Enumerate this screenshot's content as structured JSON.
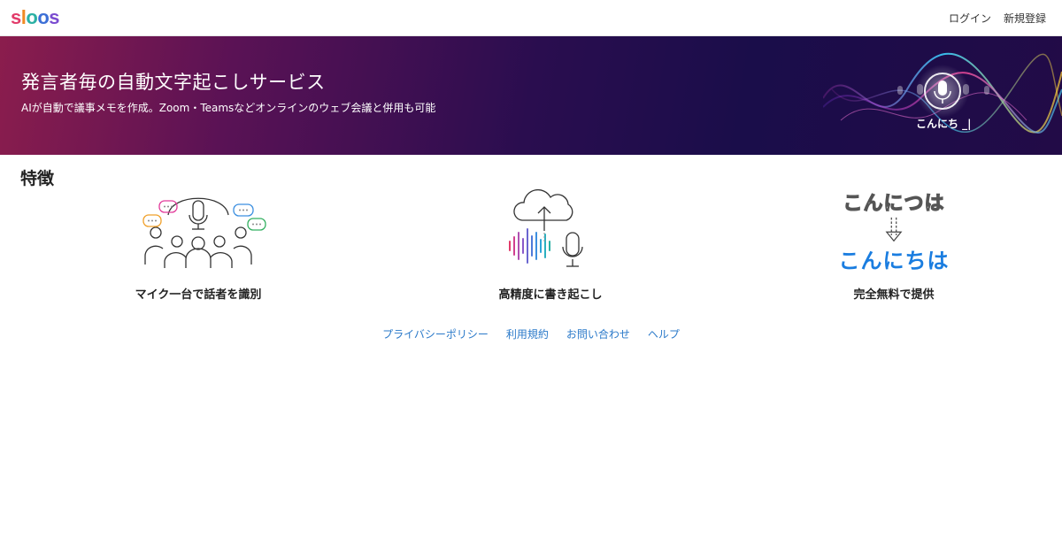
{
  "header": {
    "logo_letters": [
      "s",
      "l",
      "o",
      "o",
      "s"
    ],
    "links": {
      "login": "ログイン",
      "signup": "新規登録"
    }
  },
  "hero": {
    "title": "発言者毎の自動文字起こしサービス",
    "subtitle": "AIが自動で議事メモを作成。Zoom・Teamsなどオンラインのウェブ会議と併用も可能",
    "mic_caption": "こんにち _|"
  },
  "features": {
    "heading": "特徴",
    "items": [
      {
        "label": "マイク一台で話者を識別",
        "icon": "speakers-microphone-icon"
      },
      {
        "label": "高精度に書き起こし",
        "icon": "cloud-waveform-microphone-icon"
      },
      {
        "label": "完全無料で提供",
        "icon": "text-correction-icon",
        "before": "こんにつは",
        "after": "こんにちは"
      }
    ]
  },
  "footer": {
    "links": [
      "プライバシーポリシー",
      "利用規約",
      "お問い合わせ",
      "ヘルプ"
    ]
  },
  "colors": {
    "brand_link": "#2a79c9",
    "hero_dark": "#1a0d4a",
    "hero_accent": "#8b1d4d",
    "highlight_blue": "#1a7de0"
  }
}
